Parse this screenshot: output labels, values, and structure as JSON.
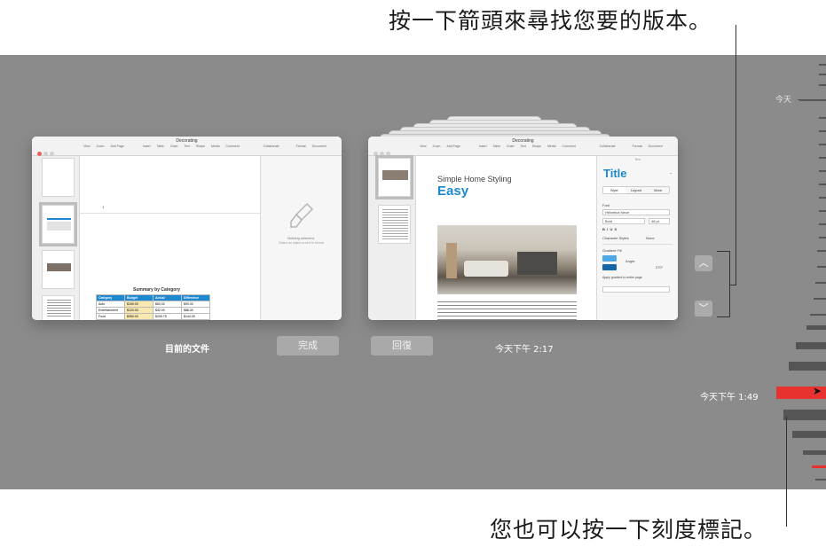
{
  "callouts": {
    "top": "按一下箭頭來尋找您要的版本。",
    "bottom": "您也可以按一下刻度標記。"
  },
  "current_doc": {
    "label": "目前的文件",
    "window_title": "Decorating",
    "toolbar_tools": [
      "View",
      "Zoom",
      "Add Page",
      "Insert",
      "Table",
      "Chart",
      "Text",
      "Shape",
      "Media",
      "Comment",
      "Collaborate",
      "Format",
      "Document"
    ],
    "zoom": "100%",
    "page_number": "1",
    "table_title": "Summary by Category",
    "table_headers": [
      "Category",
      "Budget",
      "Actual",
      "Difference"
    ],
    "table_rows": [
      [
        "Auto",
        "$150.00",
        "$60.00",
        "$90.00"
      ],
      [
        "Entertainment",
        "$120.00",
        "$32.00",
        "$88.00"
      ],
      [
        "Food",
        "$350.00",
        "$205.75",
        "$144.25"
      ]
    ],
    "inspector_empty_title": "Nothing selected.",
    "inspector_empty_sub": "Select an object or text to format"
  },
  "version_doc": {
    "timestamp": "今天下午 2:17",
    "window_title": "Decorating",
    "page_heading": "Simple Home Styling",
    "page_title": "Easy",
    "inspector": {
      "header": "Text",
      "style_name": "Title",
      "tabs": [
        "Style",
        "Layout",
        "More"
      ],
      "font_label": "Font",
      "font_name": "Helvetica Neue",
      "font_style": "Bold",
      "font_size": "48 pt",
      "char_styles_label": "Character Styles",
      "char_styles_value": "None",
      "gradient_label": "Gradient Fill",
      "angle_label": "Angle:",
      "angle_value": "270°",
      "apply_gradient": "Apply gradient to entire page"
    }
  },
  "buttons": {
    "done": "完成",
    "restore": "回復"
  },
  "timeline": {
    "today_label": "今天",
    "selected_label": "今天下午 1:49"
  },
  "colors": {
    "stage_bg": "#8b8b8b",
    "accent_blue": "#1e88d0",
    "selected_tick": "#e8322f"
  }
}
